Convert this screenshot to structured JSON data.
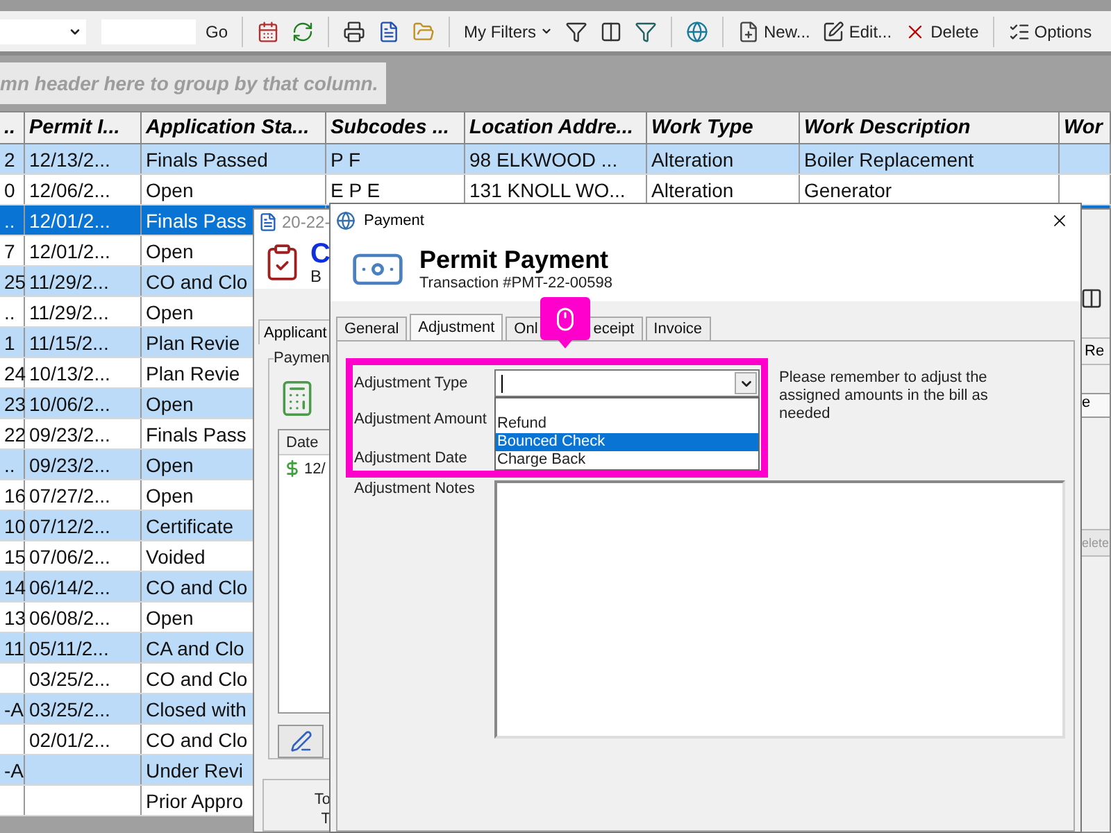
{
  "toolbar": {
    "go": "Go",
    "filters_menu": "My Filters",
    "actions": [
      "New...",
      "Edit...",
      "Delete",
      "Options"
    ]
  },
  "group_panel": {
    "hint": "mn header here to group by that column."
  },
  "table": {
    "columns": [
      "..",
      "Permit I...",
      "Application Sta...",
      "Subcodes ...",
      "Location Addre...",
      "Work Type",
      "Work Description",
      "Wor"
    ],
    "rows": [
      {
        "selected": false,
        "cells": [
          "2",
          "12/13/2...",
          "Finals Passed",
          "P F",
          "98 ELKWOOD ...",
          "Alteration",
          "Boiler Replacement"
        ]
      },
      {
        "selected": false,
        "cells": [
          "0",
          "12/06/2...",
          "Open",
          "E P E",
          "131 KNOLL WO...",
          "Alteration",
          "Generator"
        ]
      },
      {
        "selected": true,
        "cells": [
          "..",
          "12/01/2...",
          "Finals Pass"
        ]
      },
      {
        "selected": false,
        "cells": [
          "7",
          "12/01/2...",
          "Open"
        ]
      },
      {
        "selected": false,
        "cells": [
          "25",
          "11/29/2...",
          "CO and Clo"
        ]
      },
      {
        "selected": false,
        "cells": [
          "..",
          "11/29/2...",
          "Open"
        ]
      },
      {
        "selected": false,
        "cells": [
          "1",
          "11/15/2...",
          "Plan Revie"
        ]
      },
      {
        "selected": false,
        "cells": [
          "24",
          "10/13/2...",
          "Plan Revie"
        ]
      },
      {
        "selected": false,
        "cells": [
          "23",
          "10/06/2...",
          "Open"
        ]
      },
      {
        "selected": false,
        "cells": [
          "22",
          "09/23/2...",
          "Finals Pass"
        ]
      },
      {
        "selected": false,
        "cells": [
          "..",
          "09/23/2...",
          "Open"
        ]
      },
      {
        "selected": false,
        "cells": [
          "16",
          "07/27/2...",
          "Open"
        ]
      },
      {
        "selected": false,
        "cells": [
          "10",
          "07/12/2...",
          "Certificate"
        ]
      },
      {
        "selected": false,
        "cells": [
          "15",
          "07/06/2...",
          "Voided"
        ]
      },
      {
        "selected": false,
        "cells": [
          "14",
          "06/14/2...",
          "CO and Clo"
        ]
      },
      {
        "selected": false,
        "cells": [
          "13",
          "06/08/2...",
          "Open"
        ]
      },
      {
        "selected": false,
        "cells": [
          "11",
          "05/11/2...",
          "CA and Clo"
        ]
      },
      {
        "selected": false,
        "cells": [
          "",
          "03/25/2...",
          "CO and Clo"
        ]
      },
      {
        "selected": false,
        "cells": [
          "-A",
          "03/25/2...",
          "Closed with"
        ]
      },
      {
        "selected": false,
        "cells": [
          "",
          "02/01/2...",
          "CO and Clo"
        ]
      },
      {
        "selected": false,
        "cells": [
          "-A",
          "",
          "Under Revi"
        ]
      },
      {
        "selected": false,
        "cells": [
          "",
          "",
          "Prior Appro"
        ]
      }
    ]
  },
  "record_window": {
    "title": "20-22-",
    "heading": "C",
    "subheading": "B",
    "tab": "Applicant",
    "group": "Paymen",
    "list_header": "Date",
    "list_row": "12/",
    "footer_lines": [
      "To",
      "T"
    ],
    "right_tab": "Re",
    "right_header": "e",
    "right_button": "elete"
  },
  "payment_dialog": {
    "title": "Payment",
    "heading": "Permit Payment",
    "subheading": "Transaction #PMT-22-00598",
    "tabs": [
      {
        "parts": [
          "General"
        ],
        "selected": false
      },
      {
        "parts": [
          "Adjustment"
        ],
        "selected": true
      },
      {
        "parts": [
          "Onl",
          "eceipt"
        ],
        "selected": false
      },
      {
        "parts": [
          "Invoice"
        ],
        "selected": false
      }
    ],
    "labels": [
      "Adjustment Type",
      "Adjustment Amount",
      "Adjustment Date",
      "Adjustment Notes"
    ],
    "options": [
      {
        "label": "Refund",
        "selected": false
      },
      {
        "label": "Bounced Check",
        "selected": true
      },
      {
        "label": "Charge Back",
        "selected": false
      }
    ],
    "note": "Please remember to adjust the assigned amounts in the bill as needed"
  }
}
